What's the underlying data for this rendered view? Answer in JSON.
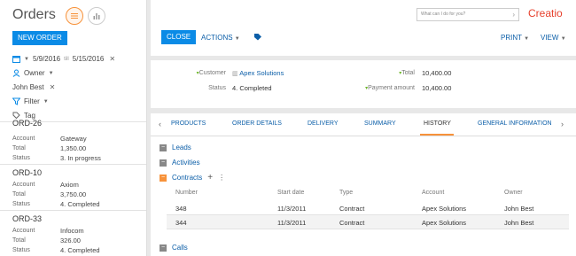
{
  "left": {
    "title": "Orders",
    "new_order": "NEW ORDER",
    "date_from": "5/9/2016",
    "date_sep": "till",
    "date_to": "5/15/2016",
    "owner_label": "Owner",
    "owner_value": "John Best",
    "filter_label": "Filter",
    "tag_label": "Tag",
    "records": [
      {
        "title": "ORD-26",
        "account": "Gateway",
        "total": "1,350.00",
        "status": "3. In progress"
      },
      {
        "title": "ORD-10",
        "account": "Axiom",
        "total": "3,750.00",
        "status": "4. Completed"
      },
      {
        "title": "ORD-33",
        "account": "Infocom",
        "total": "326.00",
        "status": "4. Completed"
      }
    ],
    "row_labels": {
      "account": "Account",
      "total": "Total",
      "status": "Status"
    }
  },
  "top": {
    "search_placeholder": "What can I do for you?",
    "logo": "Creatio",
    "close": "CLOSE",
    "actions": "ACTIONS",
    "print": "PRINT",
    "view": "VIEW"
  },
  "fields": {
    "customer_label": "Customer",
    "customer_value": "Apex Solutions",
    "status_label": "Status",
    "status_value": "4. Completed",
    "total_label": "Total",
    "total_value": "10,400.00",
    "payment_label": "Payment amount",
    "payment_value": "10,400.00"
  },
  "tabs": [
    "PRODUCTS",
    "ORDER DETAILS",
    "DELIVERY",
    "SUMMARY",
    "HISTORY",
    "GENERAL INFORMATION"
  ],
  "active_tab": "HISTORY",
  "history": {
    "leads": "Leads",
    "activities": "Activities",
    "contracts": "Contracts",
    "calls": "Calls",
    "columns": [
      "Number",
      "Start date",
      "Type",
      "Account",
      "Owner"
    ],
    "rows": [
      {
        "number": "348",
        "start": "11/3/2011",
        "type": "Contract",
        "account": "Apex Solutions",
        "owner": "John Best"
      },
      {
        "number": "344",
        "start": "11/3/2011",
        "type": "Contract",
        "account": "Apex Solutions",
        "owner": "John Best"
      }
    ]
  },
  "colors": {
    "accent": "#0b8be6",
    "orange": "#f7923a",
    "link": "#0b5ea8",
    "logo": "#e7412d"
  }
}
